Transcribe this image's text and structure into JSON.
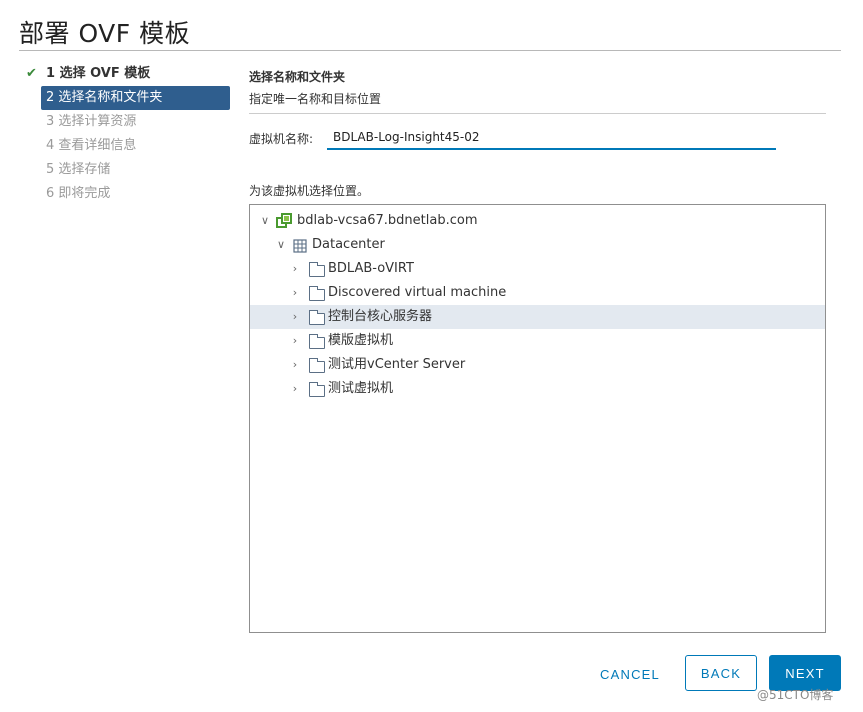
{
  "dialog": {
    "title": "部署 OVF 模板"
  },
  "steps": [
    {
      "label": "1 选择 OVF 模板",
      "state": "done"
    },
    {
      "label": "2 选择名称和文件夹",
      "state": "active"
    },
    {
      "label": "3 选择计算资源",
      "state": "pending"
    },
    {
      "label": "4 查看详细信息",
      "state": "pending"
    },
    {
      "label": "5 选择存储",
      "state": "pending"
    },
    {
      "label": "6 即将完成",
      "state": "pending"
    }
  ],
  "section": {
    "title": "选择名称和文件夹",
    "subtitle": "指定唯一名称和目标位置"
  },
  "vm_name": {
    "label": "虚拟机名称:",
    "value": "BDLAB-Log-Insight45-02"
  },
  "location": {
    "label": "为该虚拟机选择位置。"
  },
  "tree": {
    "root": {
      "label": "bdlab-vcsa67.bdnetlab.com",
      "icon": "vcenter-icon",
      "expanded": true
    },
    "datacenter": {
      "label": "Datacenter",
      "icon": "datacenter-icon",
      "expanded": true
    },
    "folders": [
      {
        "label": "BDLAB-oVIRT",
        "icon": "folder-icon"
      },
      {
        "label": "Discovered virtual machine",
        "icon": "folder-icon"
      },
      {
        "label": "控制台核心服务器",
        "icon": "folder-icon",
        "hovered": true
      },
      {
        "label": "模版虚拟机",
        "icon": "folder-icon"
      },
      {
        "label": "测试用vCenter Server",
        "icon": "folder-icon"
      },
      {
        "label": "测试虚拟机",
        "icon": "folder-icon"
      }
    ]
  },
  "footer": {
    "cancel_label": "CANCEL",
    "back_label": "BACK",
    "next_label": "NEXT"
  },
  "watermark": "@51CTO博客",
  "colors": {
    "accent": "#0079b8",
    "active_step_bg": "#2f5e8e",
    "check": "#3b8a3b",
    "hover_row": "#e3e9f0"
  }
}
